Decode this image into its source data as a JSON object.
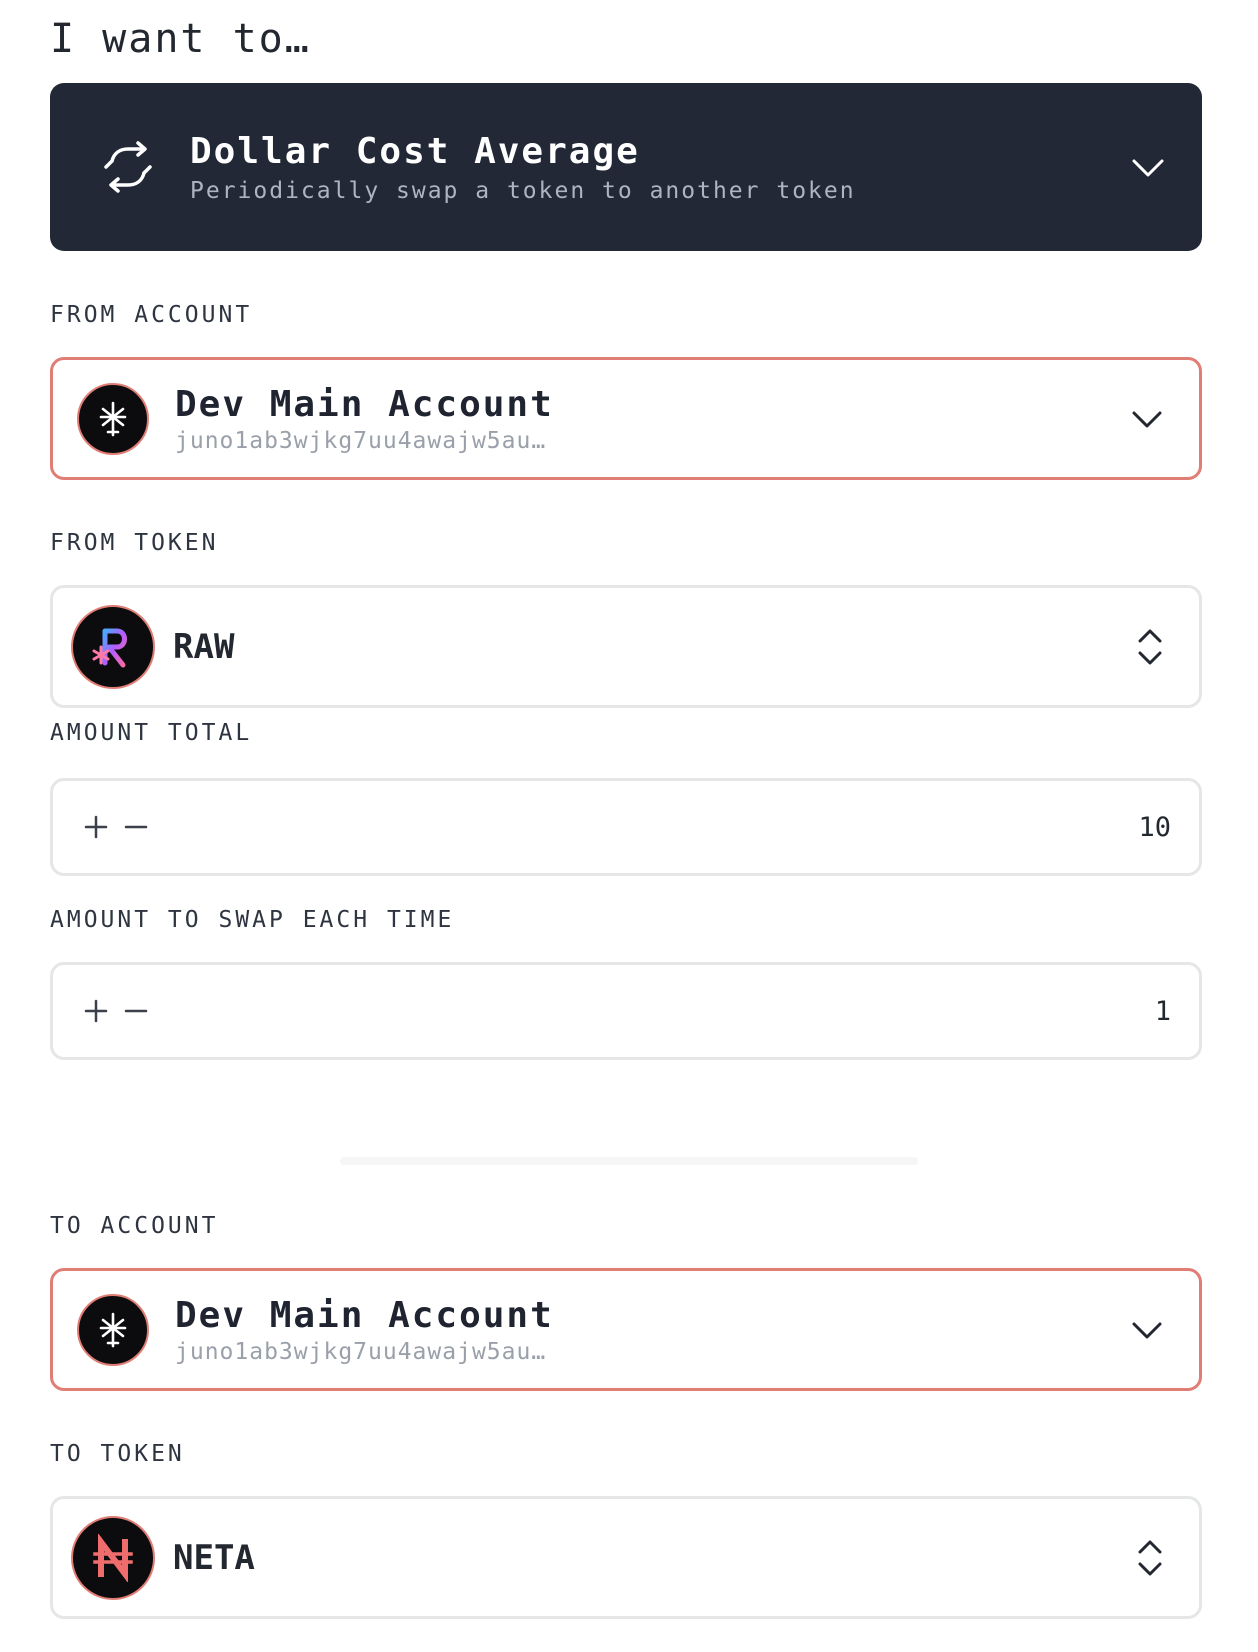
{
  "heading": "I want to…",
  "strategy": {
    "title": "Dollar Cost Average",
    "subtitle": "Periodically swap a token to another token",
    "icon": "swap-icon"
  },
  "from_account": {
    "label": "FROM ACCOUNT",
    "name": "Dev Main Account",
    "address": "juno1ab3wjkg7uu4awajw5au…"
  },
  "from_token": {
    "label": "FROM TOKEN",
    "symbol": "RAW"
  },
  "amount_total": {
    "label": "AMOUNT TOTAL",
    "value": "10"
  },
  "amount_each": {
    "label": "AMOUNT TO SWAP EACH TIME",
    "value": "1"
  },
  "to_account": {
    "label": "TO ACCOUNT",
    "name": "Dev Main Account",
    "address": "juno1ab3wjkg7uu4awajw5au…"
  },
  "to_token": {
    "label": "TO TOKEN",
    "symbol": "NETA"
  },
  "colors": {
    "dark_panel": "#222836",
    "accent_border": "#e07d75",
    "neutral_border": "#e5e6e8"
  }
}
